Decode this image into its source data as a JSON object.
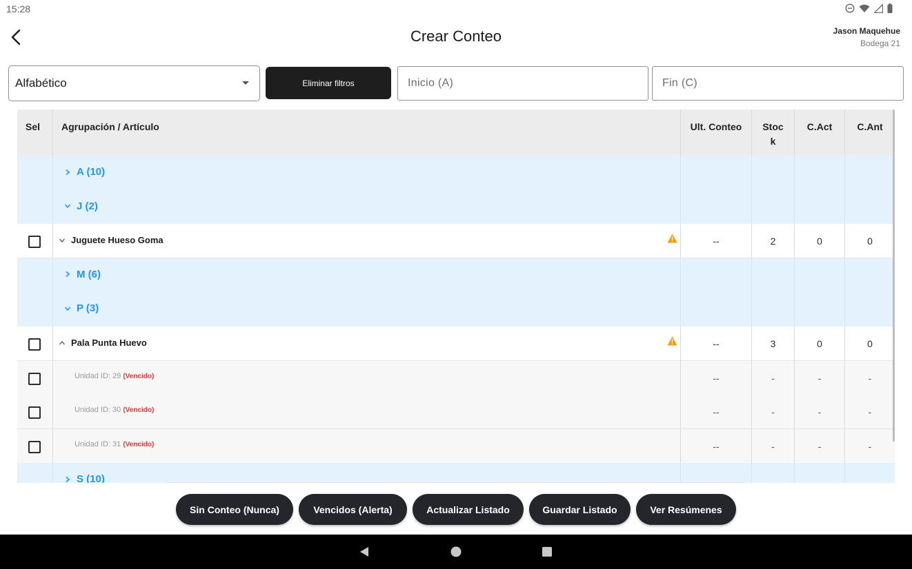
{
  "status_bar": {
    "time": "15:28",
    "icons": [
      "dnd-icon",
      "wifi-icon",
      "signal-icon",
      "battery-icon"
    ]
  },
  "header": {
    "title": "Crear Conteo",
    "user_name": "Jason Maquehue",
    "store": "Bodega 21"
  },
  "filters": {
    "sort_value": "Alfabético",
    "clear_label": "Eliminar filtros",
    "start_placeholder": "Inicio (A)",
    "end_placeholder": "Fin (C)"
  },
  "table": {
    "headers": {
      "sel": "Sel",
      "name": "Agrupación / Artículo",
      "ult": "Ult. Conteo",
      "stock": "Stock",
      "cact": "C.Act",
      "cant": "C.Ant"
    },
    "rows": [
      {
        "type": "group",
        "label": "A (10)",
        "expanded": false
      },
      {
        "type": "group",
        "label": "J (2)",
        "expanded": true
      },
      {
        "type": "item",
        "name": "Juguete Hueso Goma",
        "expanded": false,
        "warning": true,
        "ult": "--",
        "stock": "2",
        "cact": "0",
        "cant": "0"
      },
      {
        "type": "group",
        "label": "M (6)",
        "expanded": false
      },
      {
        "type": "group",
        "label": "P (3)",
        "expanded": true
      },
      {
        "type": "item",
        "name": "Pala Punta Huevo",
        "expanded": true,
        "warning": true,
        "ult": "--",
        "stock": "3",
        "cact": "0",
        "cant": "0"
      },
      {
        "type": "unit",
        "label": "Unidad ID: 29",
        "tag": "(Vencido)",
        "ult": "--",
        "stock": "-",
        "cact": "-",
        "cant": "-"
      },
      {
        "type": "unit",
        "label": "Unidad ID: 30",
        "tag": "(Vencido)",
        "ult": "--",
        "stock": "-",
        "cact": "-",
        "cant": "-"
      },
      {
        "type": "unit",
        "label": "Unidad ID: 31",
        "tag": "(Vencido)",
        "ult": "--",
        "stock": "-",
        "cact": "-",
        "cant": "-"
      },
      {
        "type": "group",
        "label": "S (10)",
        "expanded": false
      }
    ]
  },
  "actions": [
    {
      "label": "Sin Conteo (Nunca)"
    },
    {
      "label": "Vencidos (Alerta)"
    },
    {
      "label": "Actualizar Listado"
    },
    {
      "label": "Guardar Listado"
    },
    {
      "label": "Ver Resúmenes"
    }
  ],
  "colors": {
    "accent": "#2196f3",
    "group_bg": "#e3f2fd",
    "warning": "#f59e0b",
    "expired": "#e53935",
    "button_dark": "#24262b"
  },
  "nav_icons": [
    "back-triangle-icon",
    "home-circle-icon",
    "recents-square-icon"
  ]
}
